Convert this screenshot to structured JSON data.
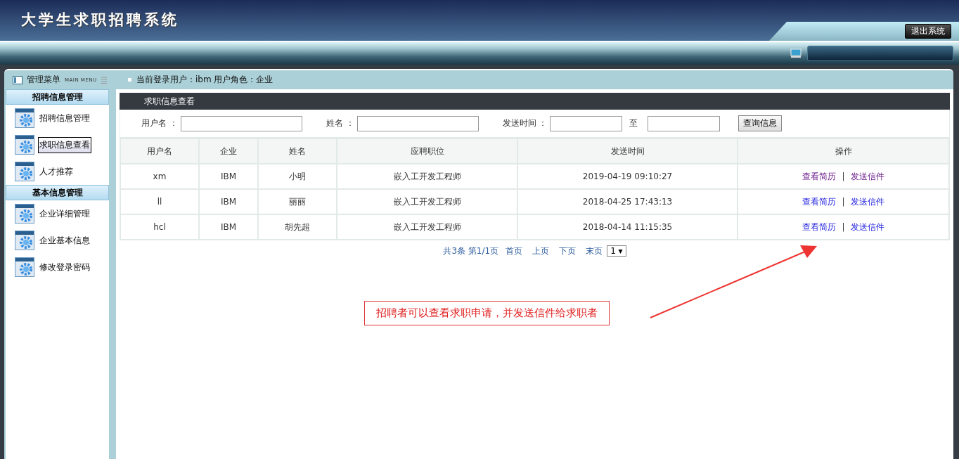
{
  "header": {
    "title": "大学生求职招聘系统",
    "logout": "退出系统"
  },
  "menu_bar": {
    "title": "管理菜单",
    "subtitle": "MAIN MENU",
    "user_info": "当前登录用户：ibm  用户角色：企业"
  },
  "sidebar": {
    "groups": [
      {
        "title": "招聘信息管理",
        "items": [
          {
            "label": "招聘信息管理",
            "selected": false
          },
          {
            "label": "求职信息查看",
            "selected": true
          },
          {
            "label": "人才推荐",
            "selected": false
          }
        ]
      },
      {
        "title": "基本信息管理",
        "items": [
          {
            "label": "企业详细管理",
            "selected": false
          },
          {
            "label": "企业基本信息",
            "selected": false
          },
          {
            "label": "修改登录密码",
            "selected": false
          }
        ]
      }
    ]
  },
  "panel": {
    "title": "求职信息查看"
  },
  "search": {
    "fields": [
      {
        "label": "用户名 ："
      },
      {
        "label": "姓名 ："
      },
      {
        "label": "发送时间 ："
      }
    ],
    "to_label": "至",
    "button": "查询信息"
  },
  "table": {
    "columns": [
      "用户名",
      "企业",
      "姓名",
      "应聘职位",
      "发送时间",
      "操作"
    ],
    "rows": [
      {
        "cells": [
          "xm",
          "IBM",
          "小明",
          "嵌入工开发工程师",
          "2019-04-19 09:10:27"
        ],
        "actions": [
          {
            "label": "查看简历",
            "visited": true
          },
          {
            "label": "发送信件",
            "visited": true
          }
        ]
      },
      {
        "cells": [
          "ll",
          "IBM",
          "丽丽",
          "嵌入工开发工程师",
          "2018-04-25 17:43:13"
        ],
        "actions": [
          {
            "label": "查看简历",
            "visited": false
          },
          {
            "label": "发送信件",
            "visited": false
          }
        ]
      },
      {
        "cells": [
          "hcl",
          "IBM",
          "胡先超",
          "嵌入工开发工程师",
          "2018-04-14 11:15:35"
        ],
        "actions": [
          {
            "label": "查看简历",
            "visited": false
          },
          {
            "label": "发送信件",
            "visited": false
          }
        ]
      }
    ],
    "separator": "|"
  },
  "pagination": {
    "summary": "共3条 第1/1页",
    "links": [
      "首页",
      "上页",
      "下页",
      "末页"
    ],
    "page_select": "1 ▾"
  },
  "annotation": {
    "text": "招聘者可以查看求职申请，并发送信件给求职者"
  }
}
